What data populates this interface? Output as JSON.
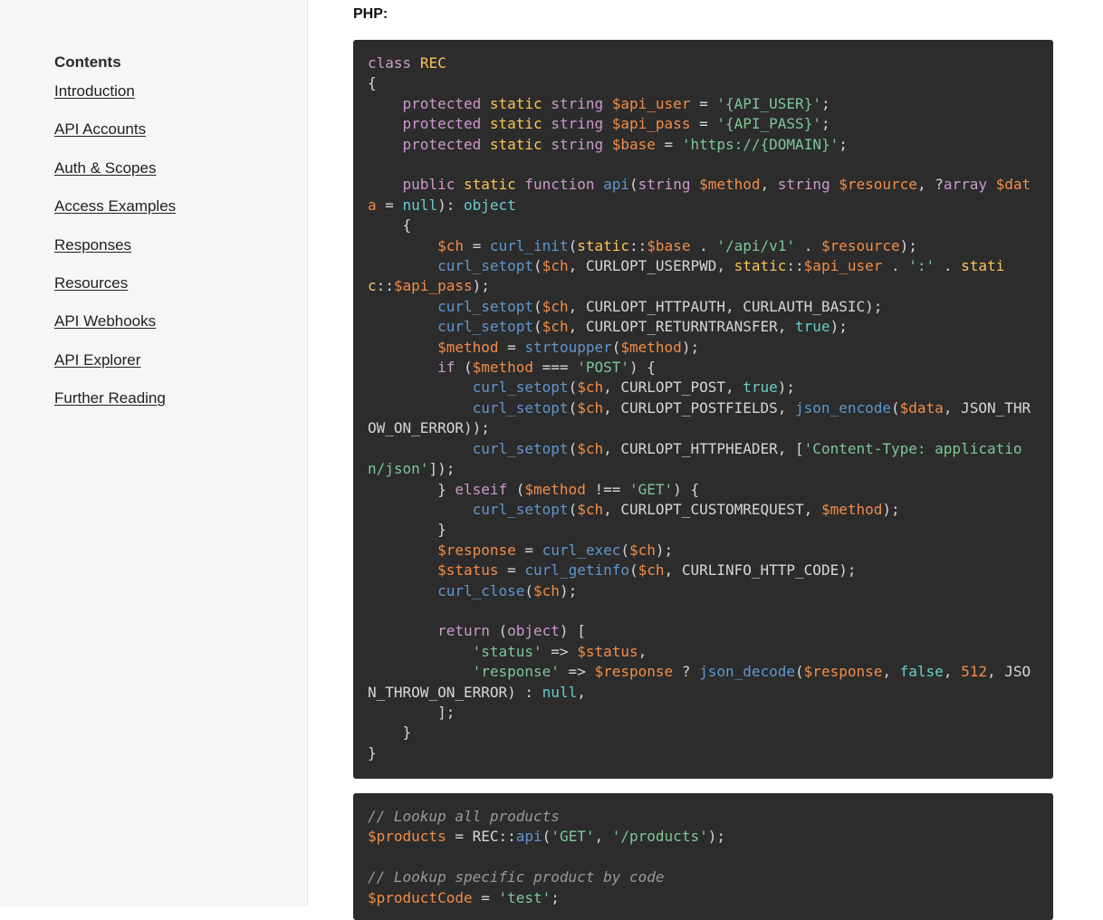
{
  "sidebar": {
    "title": "Contents",
    "items": [
      {
        "label": "Introduction"
      },
      {
        "label": "API Accounts"
      },
      {
        "label": "Auth & Scopes"
      },
      {
        "label": "Access Examples"
      },
      {
        "label": "Responses"
      },
      {
        "label": "Resources"
      },
      {
        "label": "API Webhooks"
      },
      {
        "label": "API Explorer"
      },
      {
        "label": "Further Reading"
      }
    ]
  },
  "main": {
    "language_label": "PHP:",
    "code_blocks": [
      {
        "lines": [
          [
            [
              "kw",
              "class"
            ],
            [
              "p",
              " "
            ],
            [
              "cls",
              "REC"
            ]
          ],
          [
            [
              "p",
              "{"
            ]
          ],
          [
            [
              "p",
              "    "
            ],
            [
              "kw",
              "protected"
            ],
            [
              "p",
              " "
            ],
            [
              "mod",
              "static"
            ],
            [
              "p",
              " "
            ],
            [
              "type",
              "string"
            ],
            [
              "p",
              " "
            ],
            [
              "var",
              "$api_user"
            ],
            [
              "p",
              " = "
            ],
            [
              "str",
              "'{API_USER}'"
            ],
            [
              "p",
              ";"
            ]
          ],
          [
            [
              "p",
              "    "
            ],
            [
              "kw",
              "protected"
            ],
            [
              "p",
              " "
            ],
            [
              "mod",
              "static"
            ],
            [
              "p",
              " "
            ],
            [
              "type",
              "string"
            ],
            [
              "p",
              " "
            ],
            [
              "var",
              "$api_pass"
            ],
            [
              "p",
              " = "
            ],
            [
              "str",
              "'{API_PASS}'"
            ],
            [
              "p",
              ";"
            ]
          ],
          [
            [
              "p",
              "    "
            ],
            [
              "kw",
              "protected"
            ],
            [
              "p",
              " "
            ],
            [
              "mod",
              "static"
            ],
            [
              "p",
              " "
            ],
            [
              "type",
              "string"
            ],
            [
              "p",
              " "
            ],
            [
              "var",
              "$base"
            ],
            [
              "p",
              " = "
            ],
            [
              "str",
              "'https://{DOMAIN}'"
            ],
            [
              "p",
              ";"
            ]
          ],
          [],
          [
            [
              "p",
              "    "
            ],
            [
              "kw",
              "public"
            ],
            [
              "p",
              " "
            ],
            [
              "mod",
              "static"
            ],
            [
              "p",
              " "
            ],
            [
              "kw",
              "function"
            ],
            [
              "p",
              " "
            ],
            [
              "fn",
              "api"
            ],
            [
              "p",
              "("
            ],
            [
              "type",
              "string"
            ],
            [
              "p",
              " "
            ],
            [
              "var",
              "$method"
            ],
            [
              "p",
              ", "
            ],
            [
              "type",
              "string"
            ],
            [
              "p",
              " "
            ],
            [
              "var",
              "$resource"
            ],
            [
              "p",
              ", ?"
            ],
            [
              "type",
              "array"
            ],
            [
              "p",
              " "
            ],
            [
              "var",
              "$data"
            ],
            [
              "p",
              " = "
            ],
            [
              "const",
              "null"
            ],
            [
              "p",
              "): "
            ],
            [
              "const",
              "object"
            ]
          ],
          [
            [
              "p",
              "    {"
            ]
          ],
          [
            [
              "p",
              "        "
            ],
            [
              "var",
              "$ch"
            ],
            [
              "p",
              " = "
            ],
            [
              "fn",
              "curl_init"
            ],
            [
              "p",
              "("
            ],
            [
              "mod",
              "static"
            ],
            [
              "p",
              "::"
            ],
            [
              "var",
              "$base"
            ],
            [
              "p",
              " . "
            ],
            [
              "str",
              "'/api/v1'"
            ],
            [
              "p",
              " . "
            ],
            [
              "var",
              "$resource"
            ],
            [
              "p",
              ");"
            ]
          ],
          [
            [
              "p",
              "        "
            ],
            [
              "fn",
              "curl_setopt"
            ],
            [
              "p",
              "("
            ],
            [
              "var",
              "$ch"
            ],
            [
              "p",
              ", CURLOPT_USERPWD, "
            ],
            [
              "mod",
              "static"
            ],
            [
              "p",
              "::"
            ],
            [
              "var",
              "$api_user"
            ],
            [
              "p",
              " . "
            ],
            [
              "str",
              "':'"
            ],
            [
              "p",
              " . "
            ],
            [
              "mod",
              "static"
            ],
            [
              "p",
              "::"
            ],
            [
              "var",
              "$api_pass"
            ],
            [
              "p",
              ");"
            ]
          ],
          [
            [
              "p",
              "        "
            ],
            [
              "fn",
              "curl_setopt"
            ],
            [
              "p",
              "("
            ],
            [
              "var",
              "$ch"
            ],
            [
              "p",
              ", CURLOPT_HTTPAUTH, CURLAUTH_BASIC);"
            ]
          ],
          [
            [
              "p",
              "        "
            ],
            [
              "fn",
              "curl_setopt"
            ],
            [
              "p",
              "("
            ],
            [
              "var",
              "$ch"
            ],
            [
              "p",
              ", CURLOPT_RETURNTRANSFER, "
            ],
            [
              "const",
              "true"
            ],
            [
              "p",
              ");"
            ]
          ],
          [
            [
              "p",
              "        "
            ],
            [
              "var",
              "$method"
            ],
            [
              "p",
              " = "
            ],
            [
              "fn",
              "strtoupper"
            ],
            [
              "p",
              "("
            ],
            [
              "var",
              "$method"
            ],
            [
              "p",
              ");"
            ]
          ],
          [
            [
              "p",
              "        "
            ],
            [
              "kw",
              "if"
            ],
            [
              "p",
              " ("
            ],
            [
              "var",
              "$method"
            ],
            [
              "p",
              " === "
            ],
            [
              "str",
              "'POST'"
            ],
            [
              "p",
              ") {"
            ]
          ],
          [
            [
              "p",
              "            "
            ],
            [
              "fn",
              "curl_setopt"
            ],
            [
              "p",
              "("
            ],
            [
              "var",
              "$ch"
            ],
            [
              "p",
              ", CURLOPT_POST, "
            ],
            [
              "const",
              "true"
            ],
            [
              "p",
              ");"
            ]
          ],
          [
            [
              "p",
              "            "
            ],
            [
              "fn",
              "curl_setopt"
            ],
            [
              "p",
              "("
            ],
            [
              "var",
              "$ch"
            ],
            [
              "p",
              ", CURLOPT_POSTFIELDS, "
            ],
            [
              "fn",
              "json_encode"
            ],
            [
              "p",
              "("
            ],
            [
              "var",
              "$data"
            ],
            [
              "p",
              ", JSON_THROW_ON_ERROR));"
            ]
          ],
          [
            [
              "p",
              "            "
            ],
            [
              "fn",
              "curl_setopt"
            ],
            [
              "p",
              "("
            ],
            [
              "var",
              "$ch"
            ],
            [
              "p",
              ", CURLOPT_HTTPHEADER, ["
            ],
            [
              "str",
              "'Content-Type: application/json'"
            ],
            [
              "p",
              "]);"
            ]
          ],
          [
            [
              "p",
              "        } "
            ],
            [
              "kw",
              "elseif"
            ],
            [
              "p",
              " ("
            ],
            [
              "var",
              "$method"
            ],
            [
              "p",
              " !== "
            ],
            [
              "str",
              "'GET'"
            ],
            [
              "p",
              ") {"
            ]
          ],
          [
            [
              "p",
              "            "
            ],
            [
              "fn",
              "curl_setopt"
            ],
            [
              "p",
              "("
            ],
            [
              "var",
              "$ch"
            ],
            [
              "p",
              ", CURLOPT_CUSTOMREQUEST, "
            ],
            [
              "var",
              "$method"
            ],
            [
              "p",
              ");"
            ]
          ],
          [
            [
              "p",
              "        }"
            ]
          ],
          [
            [
              "p",
              "        "
            ],
            [
              "var",
              "$response"
            ],
            [
              "p",
              " = "
            ],
            [
              "fn",
              "curl_exec"
            ],
            [
              "p",
              "("
            ],
            [
              "var",
              "$ch"
            ],
            [
              "p",
              ");"
            ]
          ],
          [
            [
              "p",
              "        "
            ],
            [
              "var",
              "$status"
            ],
            [
              "p",
              " = "
            ],
            [
              "fn",
              "curl_getinfo"
            ],
            [
              "p",
              "("
            ],
            [
              "var",
              "$ch"
            ],
            [
              "p",
              ", CURLINFO_HTTP_CODE);"
            ]
          ],
          [
            [
              "p",
              "        "
            ],
            [
              "fn",
              "curl_close"
            ],
            [
              "p",
              "("
            ],
            [
              "var",
              "$ch"
            ],
            [
              "p",
              ");"
            ]
          ],
          [],
          [
            [
              "p",
              "        "
            ],
            [
              "kw",
              "return"
            ],
            [
              "p",
              " ("
            ],
            [
              "type",
              "object"
            ],
            [
              "p",
              ") ["
            ]
          ],
          [
            [
              "p",
              "            "
            ],
            [
              "str",
              "'status'"
            ],
            [
              "p",
              " => "
            ],
            [
              "var",
              "$status"
            ],
            [
              "p",
              ","
            ]
          ],
          [
            [
              "p",
              "            "
            ],
            [
              "str",
              "'response'"
            ],
            [
              "p",
              " => "
            ],
            [
              "var",
              "$response"
            ],
            [
              "p",
              " ? "
            ],
            [
              "fn",
              "json_decode"
            ],
            [
              "p",
              "("
            ],
            [
              "var",
              "$response"
            ],
            [
              "p",
              ", "
            ],
            [
              "const",
              "false"
            ],
            [
              "p",
              ", "
            ],
            [
              "num",
              "512"
            ],
            [
              "p",
              ", JSON_THROW_ON_ERROR) : "
            ],
            [
              "const",
              "null"
            ],
            [
              "p",
              ","
            ]
          ],
          [
            [
              "p",
              "        ];"
            ]
          ],
          [
            [
              "p",
              "    }"
            ]
          ],
          [
            [
              "p",
              "}"
            ]
          ]
        ]
      },
      {
        "lines": [
          [
            [
              "com",
              "// Lookup all products"
            ]
          ],
          [
            [
              "var",
              "$products"
            ],
            [
              "p",
              " = REC::"
            ],
            [
              "fn",
              "api"
            ],
            [
              "p",
              "("
            ],
            [
              "str",
              "'GET'"
            ],
            [
              "p",
              ", "
            ],
            [
              "str",
              "'/products'"
            ],
            [
              "p",
              ");"
            ]
          ],
          [],
          [
            [
              "com",
              "// Lookup specific product by code"
            ]
          ],
          [
            [
              "var",
              "$productCode"
            ],
            [
              "p",
              " = "
            ],
            [
              "str",
              "'test'"
            ],
            [
              "p",
              ";"
            ]
          ]
        ]
      }
    ]
  }
}
